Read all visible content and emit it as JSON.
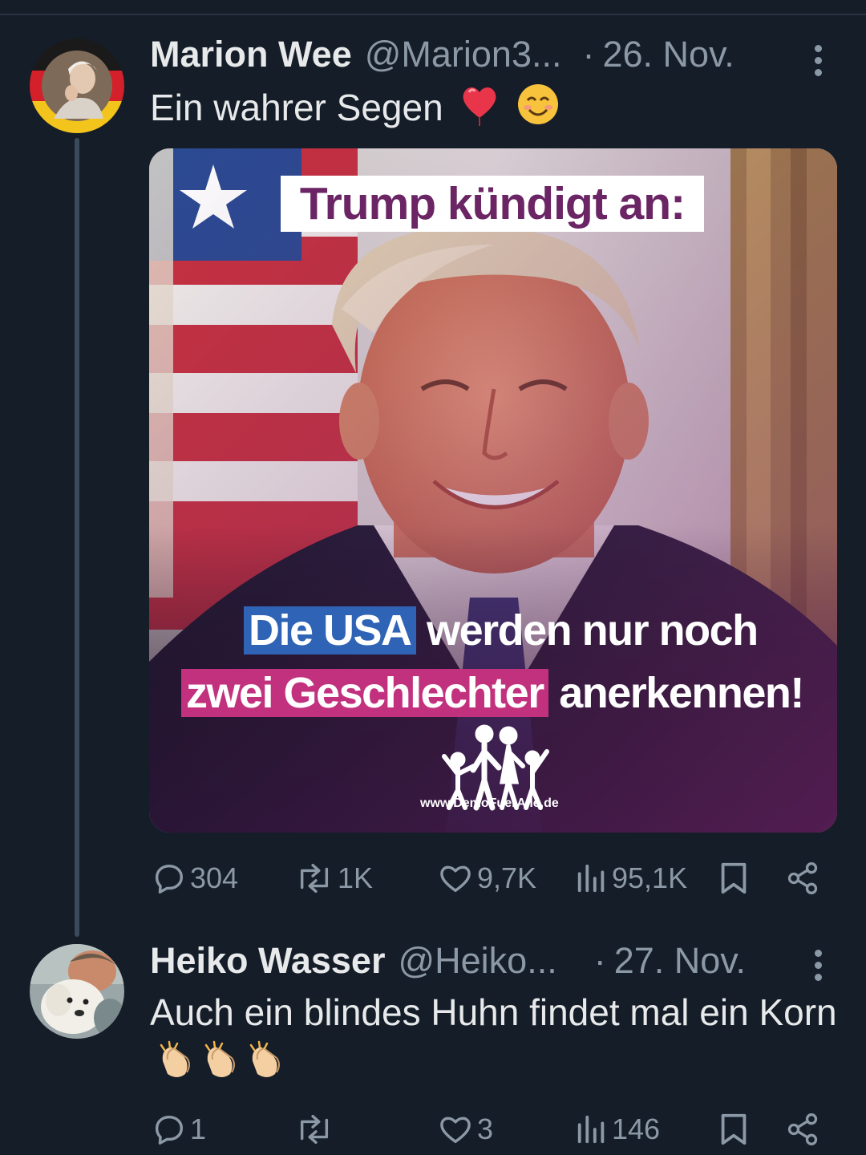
{
  "tweets": [
    {
      "author_name": "Marion Wee",
      "handle": "@Marion3...",
      "separator": "·",
      "date": "26. Nov.",
      "text": "Ein wahrer Segen",
      "emojis": [
        "heart-balloon",
        "smiling-face"
      ],
      "media": {
        "headline": "Trump kündigt an:",
        "line1": [
          "Die USA",
          "werden nur noch"
        ],
        "line2": [
          "zwei Geschlechter",
          "anerkennen!"
        ],
        "logo_url": "www.DemoFuerAlle.de"
      },
      "stats": {
        "replies": "304",
        "reposts": "1K",
        "likes": "9,7K",
        "views": "95,1K"
      }
    },
    {
      "author_name": "Heiko Wasser",
      "handle": "@Heiko...",
      "separator": "·",
      "date": "27. Nov.",
      "text": "Auch ein blindes Huhn findet mal ein Korn",
      "emojis": [
        "clapping-hands",
        "clapping-hands",
        "clapping-hands"
      ],
      "stats": {
        "replies": "1",
        "reposts": "",
        "likes": "3",
        "views": "146"
      }
    }
  ],
  "colors": {
    "background": "#151d28",
    "muted_text": "#8b98a5",
    "headline_purple": "#6b2464",
    "highlight_blue": "#2f63b5",
    "highlight_pink": "#c2317e"
  }
}
